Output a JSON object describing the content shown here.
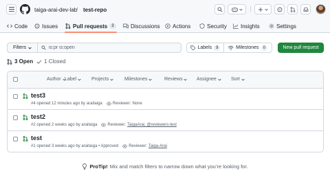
{
  "header": {
    "owner": "taiga-arai-dev-lab",
    "separator": "/",
    "repo": "test-repo",
    "icons": [
      "menu-icon",
      "github-logo",
      "search-icon",
      "copilot-icon",
      "plus-icon",
      "issues-icon",
      "pull-requests-icon",
      "inbox-icon"
    ]
  },
  "tabs": [
    {
      "label": "Code",
      "icon": "code-icon"
    },
    {
      "label": "Issues",
      "icon": "issue-icon"
    },
    {
      "label": "Pull requests",
      "icon": "pr-icon",
      "count": "3",
      "active": true
    },
    {
      "label": "Discussions",
      "icon": "discussion-icon"
    },
    {
      "label": "Actions",
      "icon": "play-icon"
    },
    {
      "label": "Security",
      "icon": "shield-icon"
    },
    {
      "label": "Insights",
      "icon": "graph-icon"
    },
    {
      "label": "Settings",
      "icon": "gear-icon"
    }
  ],
  "filterbar": {
    "filters_label": "Filters",
    "search_value": "is:pr is:open",
    "labels_label": "Labels",
    "labels_count": "9",
    "milestones_label": "Milestones",
    "milestones_count": "0",
    "new_pr_label": "New pull request"
  },
  "state": {
    "open": "3 Open",
    "closed": "1 Closed"
  },
  "list_filters": [
    "Author",
    "Label",
    "Projects",
    "Milestones",
    "Reviews",
    "Assignee",
    "Sort"
  ],
  "pull_requests": [
    {
      "title": "test3",
      "meta": "#4 opened 12 minutes ago by araitaiga",
      "reviewer_label": "Reviewer:",
      "reviewers": "None"
    },
    {
      "title": "test2",
      "meta": "#2 opened 2 weeks ago by araitaiga",
      "reviewer_label": "Reviewer:",
      "reviewers": "TaigaArai, @reviewers-test"
    },
    {
      "title": "test",
      "meta": "#1 opened 3 weeks ago by araitaiga • Approved",
      "reviewer_label": "Reviewer:",
      "reviewers": "Taiga-Arai"
    }
  ],
  "protip": {
    "bold": "ProTip!",
    "text": "Mix and match filters to narrow down what you’re looking for."
  },
  "colors": {
    "accent_green": "#1f883d",
    "tab_underline": "#fd8c73",
    "open_pr_green": "#1a7f37"
  }
}
